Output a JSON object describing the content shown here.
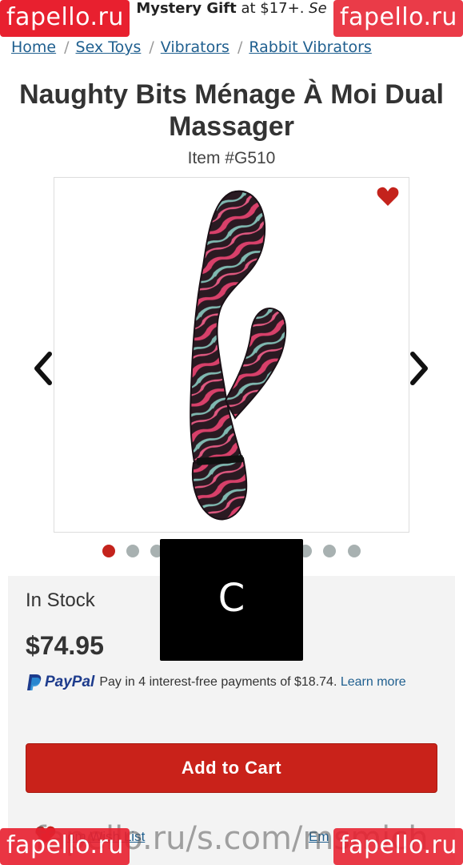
{
  "promo": {
    "bold": "Mystery Gift",
    "text": " at $17+. ",
    "italic": "Se"
  },
  "watermark": {
    "brand": "fapello.ru",
    "url": "fapello.ru/s.com/msmich"
  },
  "breadcrumb": [
    "Home",
    "Sex Toys",
    "Vibrators",
    "Rabbit Vibrators"
  ],
  "product": {
    "title": "Naughty Bits Ménage À Moi Dual Massager",
    "item_number": "Item #G510",
    "stock": "In Stock",
    "price": "$74.95"
  },
  "gallery": {
    "dot_count": 11,
    "active_dot": 0
  },
  "overlay": {
    "letter": "C"
  },
  "paypal": {
    "brand": "PayPal",
    "text": "Pay in 4 interest-free payments of $18.74.",
    "link": "Learn more"
  },
  "cart": {
    "label": "Add to Cart"
  },
  "bottom": {
    "wishlist": "om Wish List",
    "email": "Em"
  },
  "colors": {
    "accent": "#c9221a",
    "link": "#1f5f8f",
    "paypal": "#1d3b8c",
    "watermark": "#e8202f"
  }
}
